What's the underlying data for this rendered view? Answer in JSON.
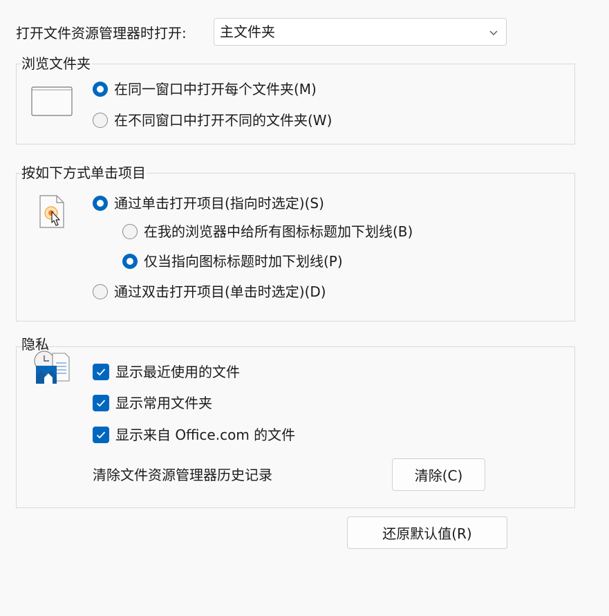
{
  "header": {
    "open_label": "打开文件资源管理器时打开:",
    "open_value": "主文件夹"
  },
  "browse": {
    "title": "浏览文件夹",
    "options": [
      {
        "label": "在同一窗口中打开每个文件夹(M)",
        "selected": true
      },
      {
        "label": "在不同窗口中打开不同的文件夹(W)",
        "selected": false
      }
    ]
  },
  "click": {
    "title": "按如下方式单击项目",
    "single": {
      "label": "通过单击打开项目(指向时选定)(S)",
      "selected": true
    },
    "underline_all": {
      "label": "在我的浏览器中给所有图标标题加下划线(B)",
      "selected": false
    },
    "underline_point": {
      "label": "仅当指向图标标题时加下划线(P)",
      "selected": true
    },
    "double": {
      "label": "通过双击打开项目(单击时选定)(D)",
      "selected": false
    }
  },
  "privacy": {
    "title": "隐私",
    "checks": [
      {
        "label": "显示最近使用的文件",
        "checked": true
      },
      {
        "label": "显示常用文件夹",
        "checked": true
      },
      {
        "label": "显示来自 Office.com 的文件",
        "checked": true
      }
    ],
    "clear_label": "清除文件资源管理器历史记录",
    "clear_button": "清除(C)"
  },
  "restore_button": "还原默认值(R)",
  "colors": {
    "accent": "#0067c0",
    "background": "#f9f9f9",
    "border": "#d9d9d9"
  }
}
